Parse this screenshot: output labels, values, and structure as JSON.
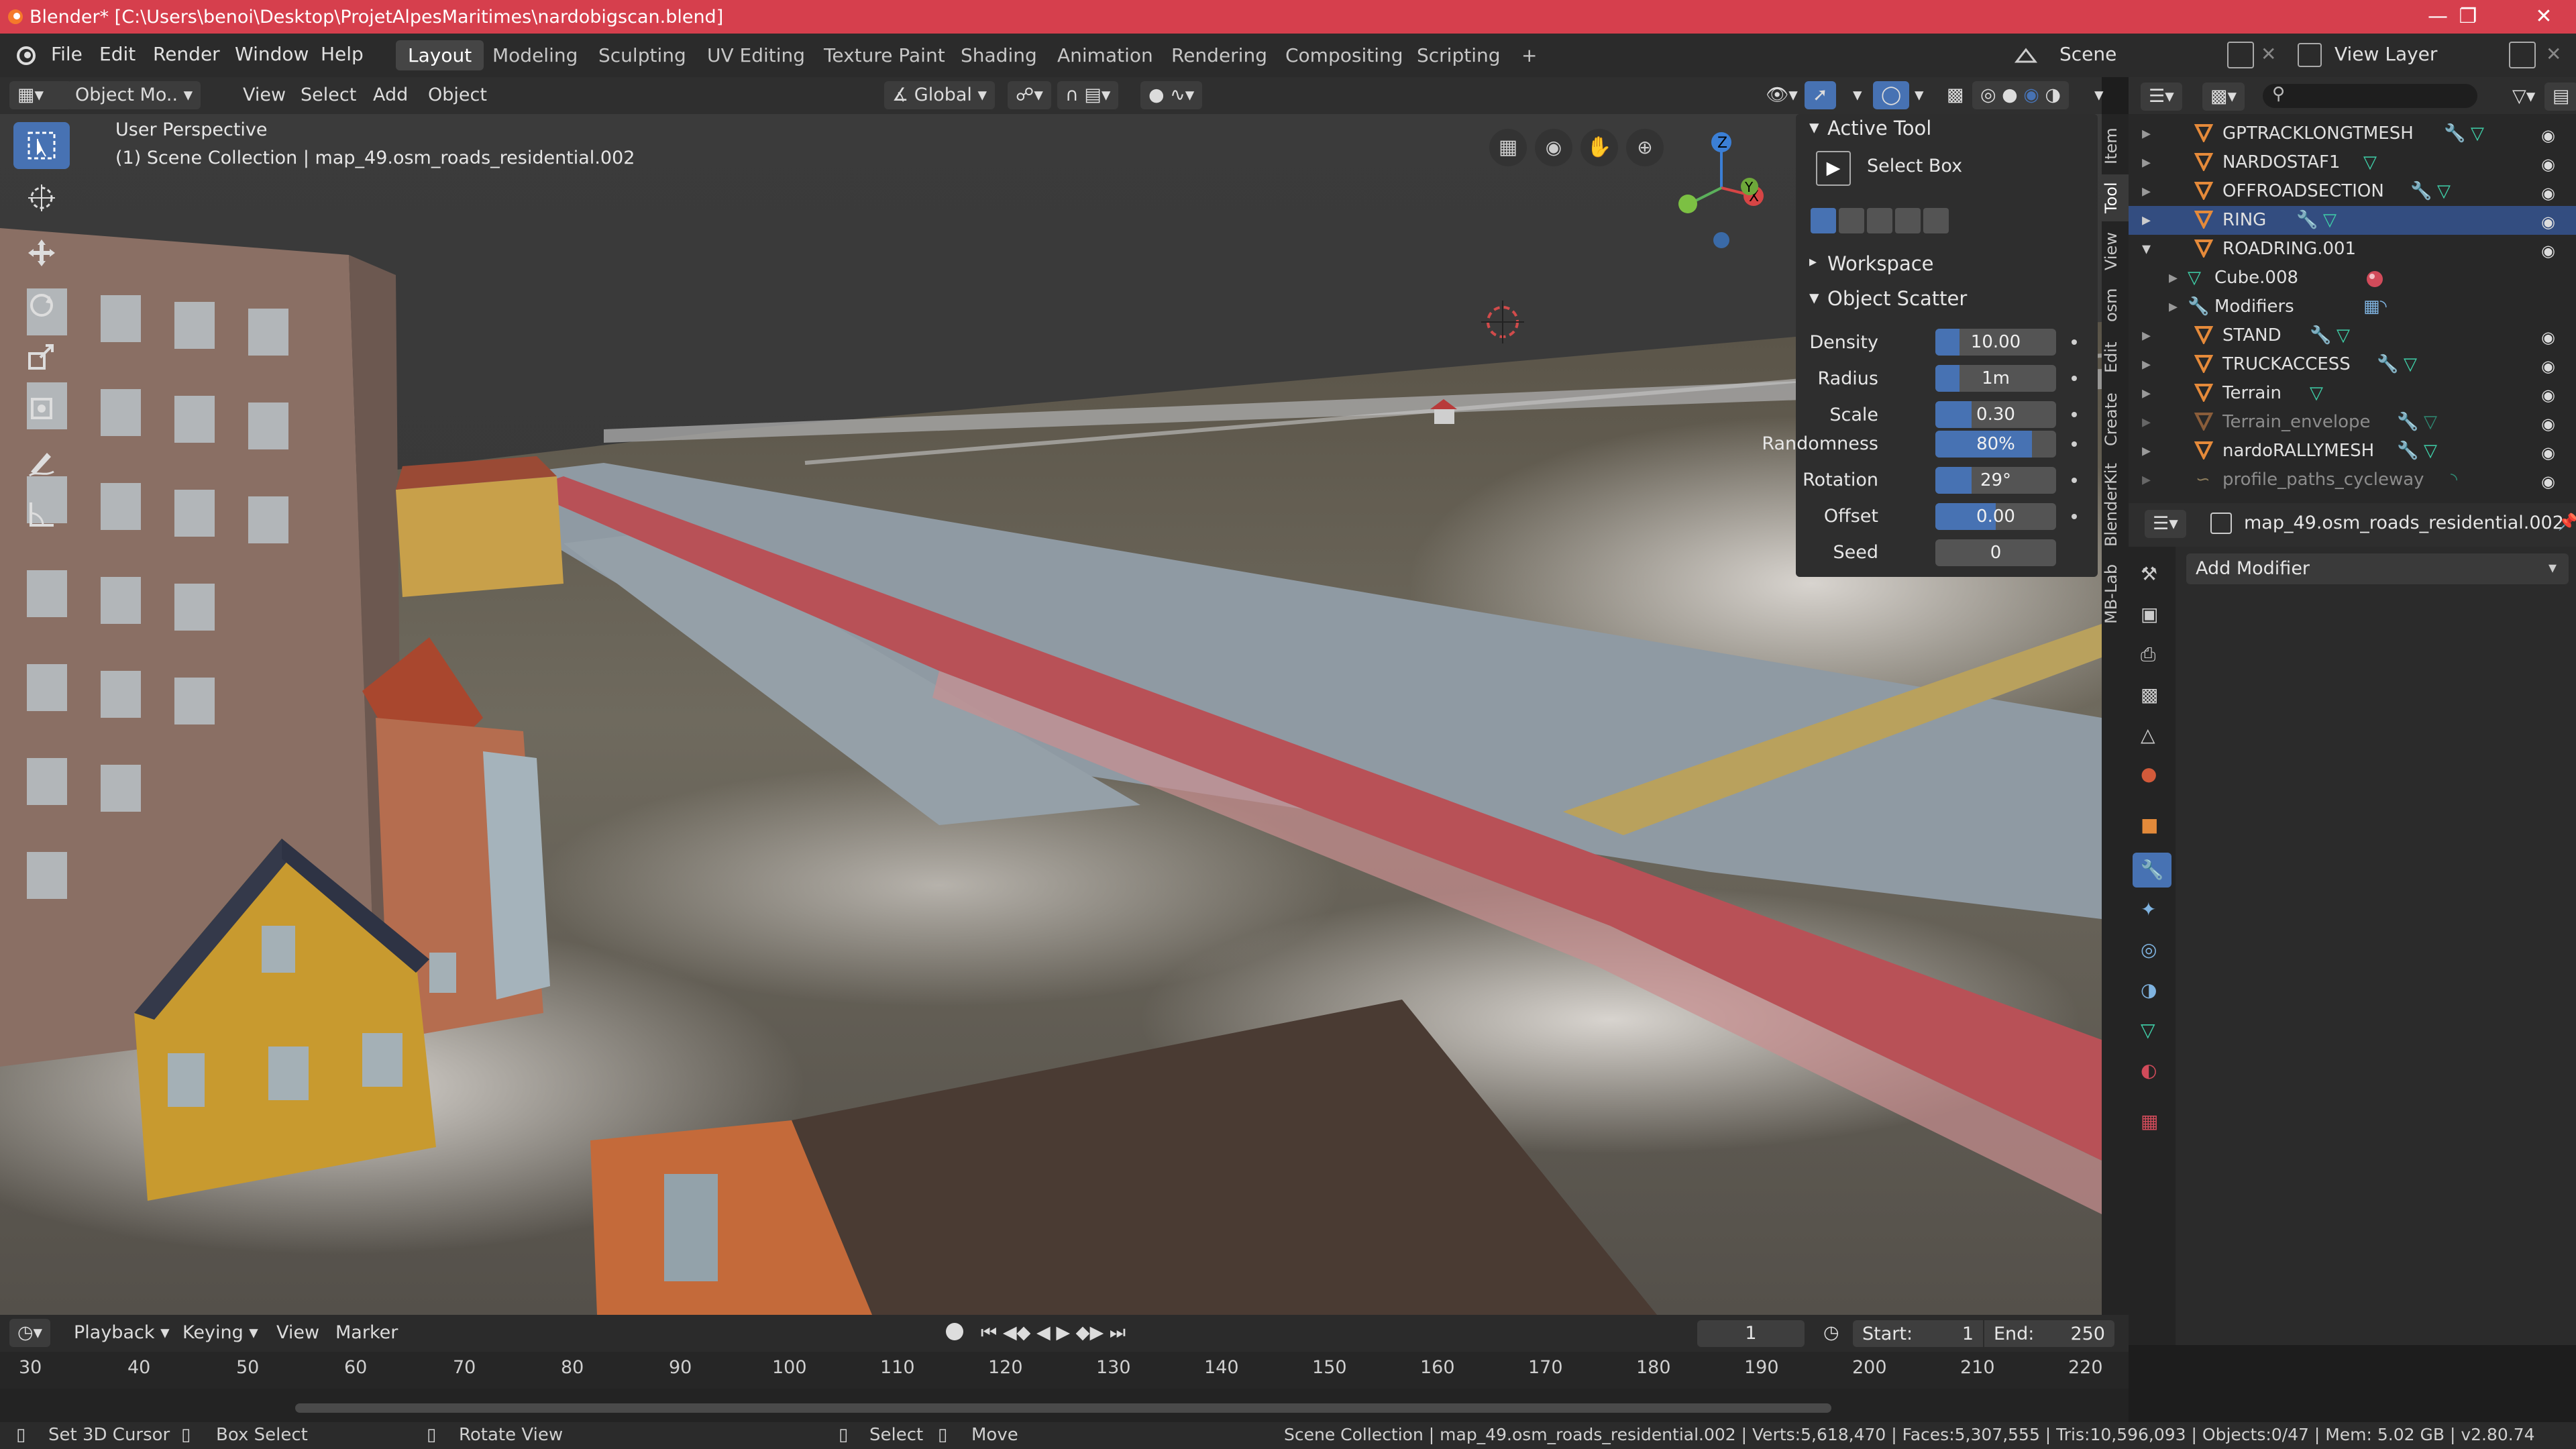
{
  "window": {
    "title": "Blender* [C:\\Users\\benoi\\Desktop\\ProjetAlpesMaritimes\\nardobigscan.blend]"
  },
  "menu": {
    "file": "File",
    "edit": "Edit",
    "render": "Render",
    "window": "Window",
    "help": "Help"
  },
  "workspaces": [
    "Layout",
    "Modeling",
    "Sculpting",
    "UV Editing",
    "Texture Paint",
    "Shading",
    "Animation",
    "Rendering",
    "Compositing",
    "Scripting",
    "+"
  ],
  "scene": {
    "name": "Scene",
    "view_layer": "View Layer"
  },
  "viewport_header": {
    "mode": "Object Mo..",
    "view": "View",
    "select": "Select",
    "add": "Add",
    "object": "Object",
    "transform": "Global"
  },
  "viewport": {
    "perspective": "User Perspective",
    "collection": "(1) Scene Collection | map_49.osm_roads_residential.002"
  },
  "npanel": {
    "active_tool_title": "Active Tool",
    "tool_name": "Select Box",
    "workspace_title": "Workspace",
    "scatter_title": "Object Scatter",
    "fields": [
      {
        "label": "Density",
        "value": "10.00",
        "fill": 0.2
      },
      {
        "label": "Radius",
        "value": "1m",
        "fill": 0.2
      },
      {
        "label": "Scale",
        "value": "0.30",
        "fill": 0.3
      },
      {
        "label": "Randomness",
        "value": "80%",
        "fill": 0.8
      },
      {
        "label": "Rotation",
        "value": "29°",
        "fill": 0.3
      },
      {
        "label": "Offset",
        "value": "0.00",
        "fill": 0.5
      },
      {
        "label": "Seed",
        "value": "0",
        "fill": 0
      }
    ]
  },
  "side_tabs": [
    "Item",
    "Tool",
    "View",
    "osm",
    "Edit",
    "Create",
    "BlenderKit",
    "MB-Lab"
  ],
  "outliner": {
    "rows": [
      {
        "name": "GPTRACKLONGTMESH",
        "dim": false,
        "sel": false
      },
      {
        "name": "NARDOSTAF1",
        "dim": false,
        "sel": false
      },
      {
        "name": "OFFROADSECTION",
        "dim": false,
        "sel": false
      },
      {
        "name": "RING",
        "dim": false,
        "sel": true
      },
      {
        "name": "ROADRING.001",
        "dim": false,
        "sel": false
      },
      {
        "name": "Cube.008",
        "dim": false,
        "sel": false
      },
      {
        "name": "Modifiers",
        "dim": false,
        "sel": false
      },
      {
        "name": "STAND",
        "dim": false,
        "sel": false
      },
      {
        "name": "TRUCKACCESS",
        "dim": false,
        "sel": false
      },
      {
        "name": "Terrain",
        "dim": false,
        "sel": false
      },
      {
        "name": "Terrain_envelope",
        "dim": true,
        "sel": false
      },
      {
        "name": "nardoRALLYMESH",
        "dim": false,
        "sel": false
      },
      {
        "name": "profile_paths_cycleway",
        "dim": true,
        "sel": false
      }
    ]
  },
  "properties": {
    "object": "map_49.osm_roads_residential.002",
    "add_modifier": "Add Modifier"
  },
  "timeline": {
    "playback": "Playback",
    "keying": "Keying",
    "view": "View",
    "marker": "Marker",
    "current_frame": "1",
    "start_label": "Start:",
    "start": "1",
    "end_label": "End:",
    "end": "250",
    "ticks": [
      "30",
      "40",
      "50",
      "60",
      "70",
      "80",
      "90",
      "100",
      "110",
      "120",
      "130",
      "140",
      "150",
      "160",
      "170",
      "180",
      "190",
      "200",
      "210",
      "220"
    ]
  },
  "statusbar": {
    "set_cursor": "Set 3D Cursor",
    "box_select": "Box Select",
    "rotate_view": "Rotate View",
    "select": "Select",
    "move": "Move",
    "stats": "Scene Collection | map_49.osm_roads_residential.002 | Verts:5,618,470 | Faces:5,307,555 | Tris:10,596,093 | Objects:0/47 | Mem: 5.02 GB | v2.80.74"
  },
  "colors": {
    "titlebar": "#d63f4d",
    "accent": "#4772b3",
    "selection": "#334d80"
  }
}
